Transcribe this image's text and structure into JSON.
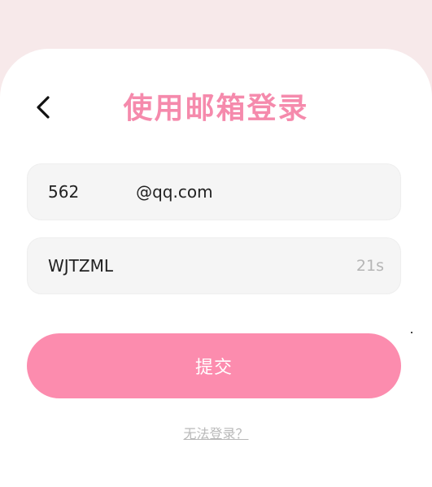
{
  "header": {
    "title": "使用邮箱登录",
    "back_icon": "chevron-left-icon"
  },
  "form": {
    "email_value": "562           @qq.com",
    "code_value": "WJTZML",
    "countdown": "21s"
  },
  "actions": {
    "submit_label": "提交",
    "help_link": "无法登录？"
  },
  "colors": {
    "accent": "#fc8cae",
    "title": "#f58aac",
    "background": "#f7e9ea",
    "field_bg": "#f5f5f5"
  }
}
